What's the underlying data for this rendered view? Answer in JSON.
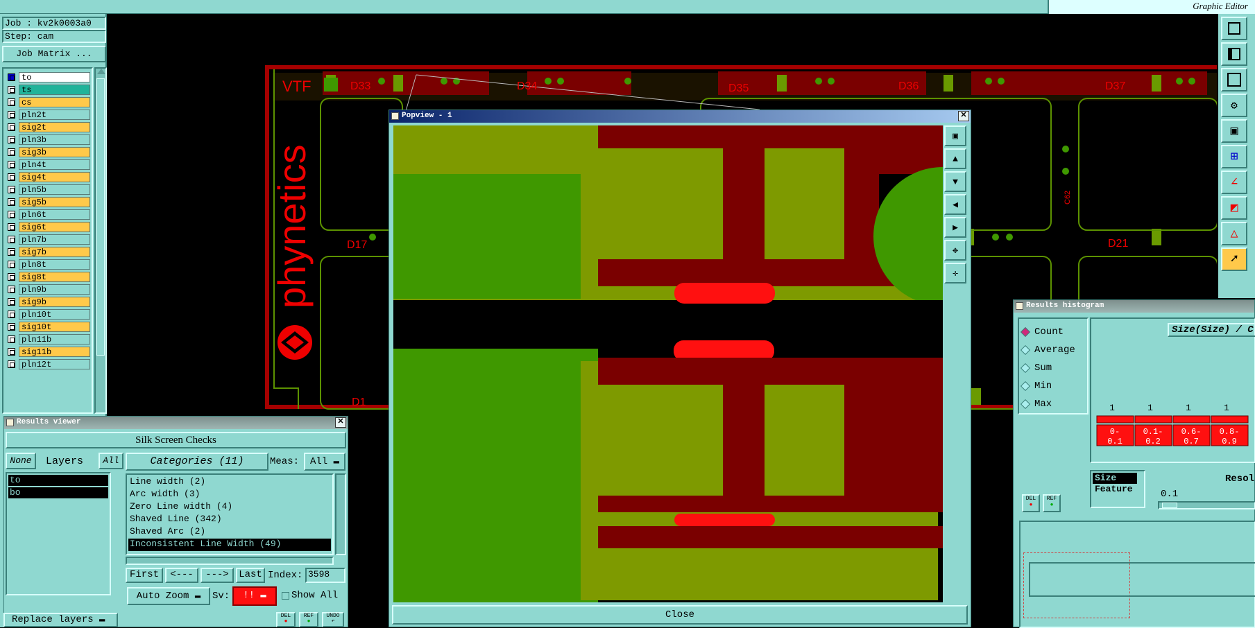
{
  "top": {
    "right_title": "Graphic Editor"
  },
  "job": {
    "job_label": "Job : kv2k0003a0",
    "step_label": "Step: cam",
    "matrix_button": "Job Matrix ..."
  },
  "layers": [
    {
      "name": "to",
      "color": "#ffffff"
    },
    {
      "name": "ts",
      "color": "#21b39a"
    },
    {
      "name": "cs",
      "color": "#ffc94a"
    },
    {
      "name": "pln2t",
      "color": "#8fd8d0"
    },
    {
      "name": "sig2t",
      "color": "#ffc94a"
    },
    {
      "name": "pln3b",
      "color": "#8fd8d0"
    },
    {
      "name": "sig3b",
      "color": "#ffc94a"
    },
    {
      "name": "pln4t",
      "color": "#8fd8d0"
    },
    {
      "name": "sig4t",
      "color": "#ffc94a"
    },
    {
      "name": "pln5b",
      "color": "#8fd8d0"
    },
    {
      "name": "sig5b",
      "color": "#ffc94a"
    },
    {
      "name": "pln6t",
      "color": "#8fd8d0"
    },
    {
      "name": "sig6t",
      "color": "#ffc94a"
    },
    {
      "name": "pln7b",
      "color": "#8fd8d0"
    },
    {
      "name": "sig7b",
      "color": "#ffc94a"
    },
    {
      "name": "pln8t",
      "color": "#8fd8d0"
    },
    {
      "name": "sig8t",
      "color": "#ffc94a"
    },
    {
      "name": "pln9b",
      "color": "#8fd8d0"
    },
    {
      "name": "sig9b",
      "color": "#ffc94a"
    },
    {
      "name": "pln10t",
      "color": "#8fd8d0"
    },
    {
      "name": "sig10t",
      "color": "#ffc94a"
    },
    {
      "name": "pln11b",
      "color": "#8fd8d0"
    },
    {
      "name": "sig11b",
      "color": "#ffc94a"
    },
    {
      "name": "pln12t",
      "color": "#8fd8d0"
    }
  ],
  "board": {
    "vtf": "VTF",
    "brand": "phynetics",
    "refs": [
      "D33",
      "D34",
      "D35",
      "D36",
      "D37",
      "D17",
      "D21",
      "D1"
    ],
    "c62": "C62"
  },
  "popview": {
    "title": "Popview - 1",
    "close": "Close"
  },
  "results_viewer": {
    "title": "Results viewer",
    "header": "Silk Screen Checks",
    "none_btn": "None",
    "layers_label": "Layers",
    "all_btn": "All",
    "layer_items": [
      "to",
      "bo"
    ],
    "categories_label": "Categories (11)",
    "meas_label": "Meas:",
    "meas_value": "All",
    "categories": [
      "Line width (2)",
      "Arc width (3)",
      "Zero Line width (4)",
      "Shaved Line (342)",
      "Shaved Arc (2)",
      "Inconsistent Line Width (49)"
    ],
    "first": "First",
    "prev": "<---",
    "next": "--->",
    "last": "Last",
    "index_label": "Index:",
    "index_value": "3598",
    "auto_zoom": "Auto Zoom",
    "sv_label": "Sv:",
    "sv_value": "!!",
    "show_all": "Show All",
    "del": "DEL",
    "ref": "REF",
    "undo": "UNDO"
  },
  "replace_layers": "Replace layers",
  "histogram": {
    "title": "Results histogram",
    "modes": [
      "Count",
      "Average",
      "Sum",
      "Min",
      "Max"
    ],
    "selected_mode": "Count",
    "chart_title": "Size(Size) / C",
    "bin_counts": [
      "1",
      "1",
      "1",
      "1"
    ],
    "bin_labels": [
      "0-\n0.1",
      "0.1-\n0.2",
      "0.6-\n0.7",
      "0.8-\n0.9"
    ],
    "fields": [
      "Size",
      "Feature"
    ],
    "resol_label": "Resol",
    "resol_value": "0.1",
    "del": "DEL",
    "ref": "REF"
  },
  "colors": {
    "teal": "#8fd8d0",
    "red": "#ff1010",
    "green": "#4e9a00",
    "olive": "#7e9a00",
    "darkred": "#7a0000"
  }
}
